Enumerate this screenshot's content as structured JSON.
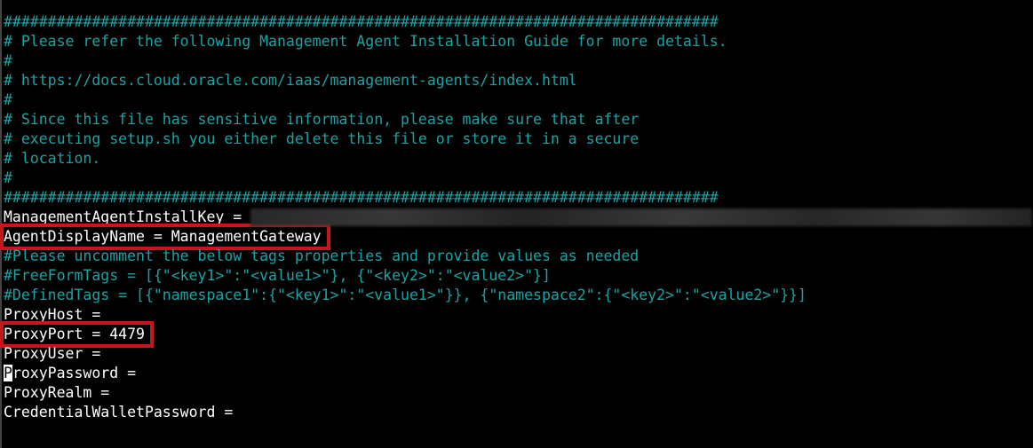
{
  "lines": {
    "l0": "#################################################################################",
    "l1": "# Please refer the following Management Agent Installation Guide for more details.",
    "l2": "#",
    "l3": "# https://docs.cloud.oracle.com/iaas/management-agents/index.html",
    "l4": "#",
    "l5": "# Since this file has sensitive information, please make sure that after",
    "l6": "# executing setup.sh you either delete this file or store it in a secure",
    "l7": "# location.",
    "l8": "#",
    "l9": "#################################################################################",
    "l10": "ManagementAgentInstallKey = ",
    "l11": "AgentDisplayName = ManagementGateway",
    "l12": "#Please uncomment the below tags properties and provide values as needed",
    "l13": "#FreeFormTags = [{\"<key1>\":\"<value1>\"}, {\"<key2>\":\"<value2>\"}]",
    "l14": "#DefinedTags = [{\"namespace1\":{\"<key1>\":\"<value1>\"}}, {\"namespace2\":{\"<key2>\":\"<value2>\"}}]",
    "l15": "ProxyHost =",
    "l16": "ProxyPort = 4479",
    "l17": "ProxyUser =",
    "l18_cursor": "P",
    "l18_rest": "roxyPassword =",
    "l19": "ProxyRealm =",
    "l20": "CredentialWalletPassword ="
  },
  "colors": {
    "comment": "#1aa3a3",
    "text": "#ffffff",
    "background": "#000000",
    "highlight_box": "#c4161c"
  }
}
